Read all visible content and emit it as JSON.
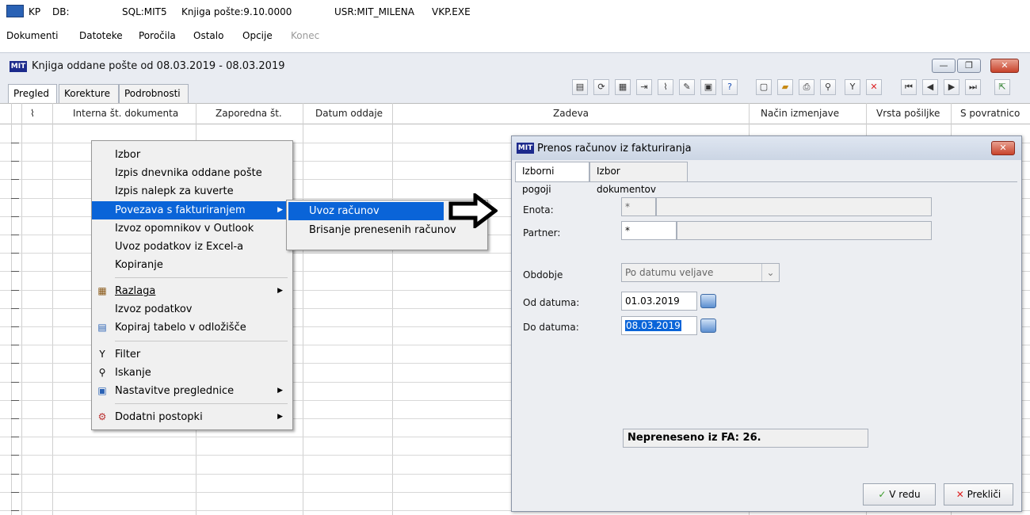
{
  "app": {
    "title_app": "KP",
    "title_db": "DB:",
    "title_sql": "SQL:MIT5",
    "title_version": "Knjiga pošte:9.10.0000",
    "title_user": "USR:MIT_MILENA",
    "title_exe": "VKP.EXE"
  },
  "menubar": [
    "Dokumenti",
    "Datoteke",
    "Poročila",
    "Ostalo",
    "Opcije",
    "Konec"
  ],
  "child_window": {
    "title": "Knjiga oddane pošte od 08.03.2019 - 08.03.2019",
    "logo": "MIT",
    "tabs": [
      "Pregled",
      "Korekture",
      "Podrobnosti"
    ]
  },
  "grid": {
    "columns": [
      "Interna št. dokumenta",
      "Zaporedna št.",
      "Datum oddaje",
      "Zadeva",
      "Način izmenjave",
      "Vrsta pošiljke",
      "S povratnico"
    ]
  },
  "context_menu": {
    "items": [
      {
        "label": "Izbor"
      },
      {
        "label": "Izpis dnevnika oddane pošte"
      },
      {
        "label": "Izpis nalepk za kuverte"
      },
      {
        "label": "Povezava s fakturiranjem",
        "submenu": true,
        "highlight": true
      },
      {
        "label": "Izvoz opomnikov v Outlook"
      },
      {
        "label": "Uvoz podatkov iz Excel-a"
      },
      {
        "label": "Kopiranje"
      },
      {
        "label": "Razlaga",
        "submenu": true,
        "icon": "explain-icon"
      },
      {
        "label": "Izvoz podatkov"
      },
      {
        "label": "Kopiraj tabelo v odložišče",
        "icon": "clipboard-icon"
      },
      {
        "label": "Filter",
        "icon": "filter-icon"
      },
      {
        "label": "Iskanje",
        "icon": "search-icon"
      },
      {
        "label": "Nastavitve preglednice",
        "submenu": true,
        "icon": "settings-icon"
      },
      {
        "label": "Dodatni postopki",
        "submenu": true,
        "icon": "gear-icon"
      }
    ],
    "submenu_items": [
      "Uvoz računov",
      "Brisanje prenesenih računov"
    ]
  },
  "dialog": {
    "title": "Prenos računov iz fakturiranja",
    "logo": "MIT",
    "tabs": [
      "Izborni pogoji",
      "Izbor dokumentov"
    ],
    "enota_label": "Enota:",
    "enota_value": "*",
    "partner_label": "Partner:",
    "partner_value": "*",
    "obdobje_label": "Obdobje",
    "obdobje_value": "Po datumu veljave",
    "od_label": "Od datuma:",
    "od_value": "01.03.2019",
    "do_label": "Do datuma:",
    "do_value": "08.03.2019",
    "status": "Nepreneseno iz FA: 26.",
    "ok_label": "V redu",
    "cancel_label": "Prekliči"
  },
  "colors": {
    "menu_highlight": "#0a64d8",
    "logo_blue": "#1c2a8c",
    "close_red": "#c8432b"
  }
}
